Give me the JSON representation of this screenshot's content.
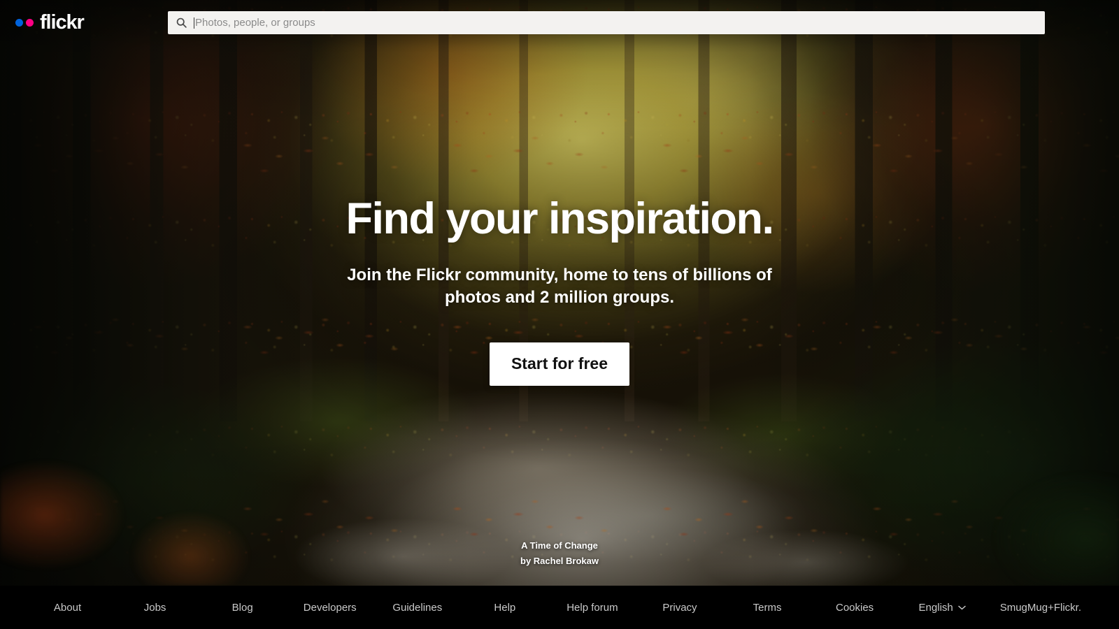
{
  "brand": {
    "name": "flickr",
    "dot_blue": "#0063DC",
    "dot_pink": "#FF0084"
  },
  "search": {
    "placeholder": "Photos, people, or groups",
    "value": "",
    "icon": "search-icon"
  },
  "hero": {
    "headline": "Find your inspiration.",
    "subheadline": "Join the Flickr community, home to tens of billions of photos and 2 million groups.",
    "cta_label": "Start for free",
    "photo_title": "A Time of Change",
    "photo_author": "by Rachel Brokaw"
  },
  "footer": {
    "links": [
      {
        "label": "About",
        "name": "about"
      },
      {
        "label": "Jobs",
        "name": "jobs"
      },
      {
        "label": "Blog",
        "name": "blog"
      },
      {
        "label": "Developers",
        "name": "developers"
      },
      {
        "label": "Guidelines",
        "name": "guidelines"
      },
      {
        "label": "Help",
        "name": "help"
      },
      {
        "label": "Help forum",
        "name": "help-forum"
      },
      {
        "label": "Privacy",
        "name": "privacy"
      },
      {
        "label": "Terms",
        "name": "terms"
      },
      {
        "label": "Cookies",
        "name": "cookies"
      }
    ],
    "language": "English",
    "language_chevron": "chevron-down-icon",
    "brand_note": "SmugMug+Flickr."
  }
}
